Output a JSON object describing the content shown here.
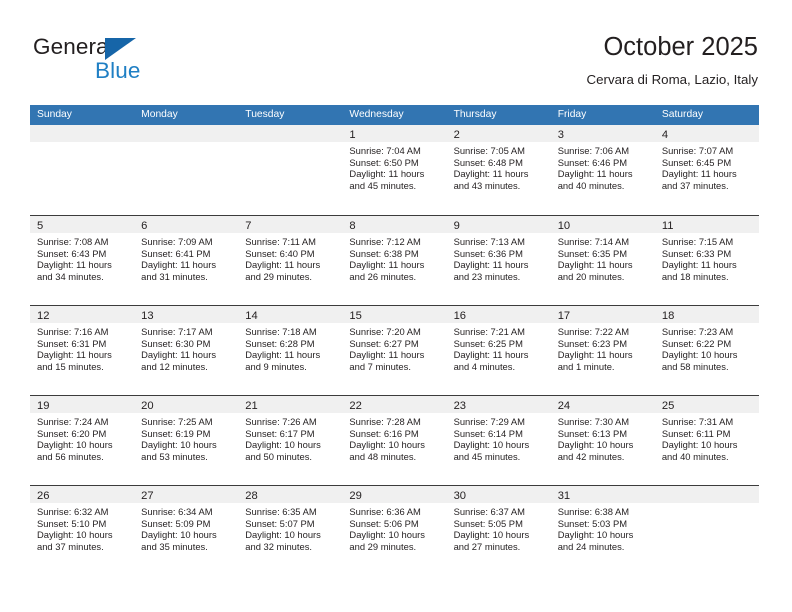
{
  "brand": {
    "name_top": "General",
    "name_bottom": "Blue",
    "triangle_color": "#1665a8",
    "blue_text_color": "#1f7fc4"
  },
  "header": {
    "title": "October 2025",
    "subtitle": "Cervara di Roma, Lazio, Italy"
  },
  "theme": {
    "header_blue": "#3275b2",
    "day_band_gray": "#f0f0f0",
    "rule_color": "#3c3c3c",
    "text_color": "#231f20"
  },
  "weekdays": [
    "Sunday",
    "Monday",
    "Tuesday",
    "Wednesday",
    "Thursday",
    "Friday",
    "Saturday"
  ],
  "weeks": [
    [
      {
        "empty": true
      },
      {
        "empty": true
      },
      {
        "empty": true
      },
      {
        "day": "1",
        "sunrise": "Sunrise: 7:04 AM",
        "sunset": "Sunset: 6:50 PM",
        "daylight": "Daylight: 11 hours and 45 minutes."
      },
      {
        "day": "2",
        "sunrise": "Sunrise: 7:05 AM",
        "sunset": "Sunset: 6:48 PM",
        "daylight": "Daylight: 11 hours and 43 minutes."
      },
      {
        "day": "3",
        "sunrise": "Sunrise: 7:06 AM",
        "sunset": "Sunset: 6:46 PM",
        "daylight": "Daylight: 11 hours and 40 minutes."
      },
      {
        "day": "4",
        "sunrise": "Sunrise: 7:07 AM",
        "sunset": "Sunset: 6:45 PM",
        "daylight": "Daylight: 11 hours and 37 minutes."
      }
    ],
    [
      {
        "day": "5",
        "sunrise": "Sunrise: 7:08 AM",
        "sunset": "Sunset: 6:43 PM",
        "daylight": "Daylight: 11 hours and 34 minutes."
      },
      {
        "day": "6",
        "sunrise": "Sunrise: 7:09 AM",
        "sunset": "Sunset: 6:41 PM",
        "daylight": "Daylight: 11 hours and 31 minutes."
      },
      {
        "day": "7",
        "sunrise": "Sunrise: 7:11 AM",
        "sunset": "Sunset: 6:40 PM",
        "daylight": "Daylight: 11 hours and 29 minutes."
      },
      {
        "day": "8",
        "sunrise": "Sunrise: 7:12 AM",
        "sunset": "Sunset: 6:38 PM",
        "daylight": "Daylight: 11 hours and 26 minutes."
      },
      {
        "day": "9",
        "sunrise": "Sunrise: 7:13 AM",
        "sunset": "Sunset: 6:36 PM",
        "daylight": "Daylight: 11 hours and 23 minutes."
      },
      {
        "day": "10",
        "sunrise": "Sunrise: 7:14 AM",
        "sunset": "Sunset: 6:35 PM",
        "daylight": "Daylight: 11 hours and 20 minutes."
      },
      {
        "day": "11",
        "sunrise": "Sunrise: 7:15 AM",
        "sunset": "Sunset: 6:33 PM",
        "daylight": "Daylight: 11 hours and 18 minutes."
      }
    ],
    [
      {
        "day": "12",
        "sunrise": "Sunrise: 7:16 AM",
        "sunset": "Sunset: 6:31 PM",
        "daylight": "Daylight: 11 hours and 15 minutes."
      },
      {
        "day": "13",
        "sunrise": "Sunrise: 7:17 AM",
        "sunset": "Sunset: 6:30 PM",
        "daylight": "Daylight: 11 hours and 12 minutes."
      },
      {
        "day": "14",
        "sunrise": "Sunrise: 7:18 AM",
        "sunset": "Sunset: 6:28 PM",
        "daylight": "Daylight: 11 hours and 9 minutes."
      },
      {
        "day": "15",
        "sunrise": "Sunrise: 7:20 AM",
        "sunset": "Sunset: 6:27 PM",
        "daylight": "Daylight: 11 hours and 7 minutes."
      },
      {
        "day": "16",
        "sunrise": "Sunrise: 7:21 AM",
        "sunset": "Sunset: 6:25 PM",
        "daylight": "Daylight: 11 hours and 4 minutes."
      },
      {
        "day": "17",
        "sunrise": "Sunrise: 7:22 AM",
        "sunset": "Sunset: 6:23 PM",
        "daylight": "Daylight: 11 hours and 1 minute."
      },
      {
        "day": "18",
        "sunrise": "Sunrise: 7:23 AM",
        "sunset": "Sunset: 6:22 PM",
        "daylight": "Daylight: 10 hours and 58 minutes."
      }
    ],
    [
      {
        "day": "19",
        "sunrise": "Sunrise: 7:24 AM",
        "sunset": "Sunset: 6:20 PM",
        "daylight": "Daylight: 10 hours and 56 minutes."
      },
      {
        "day": "20",
        "sunrise": "Sunrise: 7:25 AM",
        "sunset": "Sunset: 6:19 PM",
        "daylight": "Daylight: 10 hours and 53 minutes."
      },
      {
        "day": "21",
        "sunrise": "Sunrise: 7:26 AM",
        "sunset": "Sunset: 6:17 PM",
        "daylight": "Daylight: 10 hours and 50 minutes."
      },
      {
        "day": "22",
        "sunrise": "Sunrise: 7:28 AM",
        "sunset": "Sunset: 6:16 PM",
        "daylight": "Daylight: 10 hours and 48 minutes."
      },
      {
        "day": "23",
        "sunrise": "Sunrise: 7:29 AM",
        "sunset": "Sunset: 6:14 PM",
        "daylight": "Daylight: 10 hours and 45 minutes."
      },
      {
        "day": "24",
        "sunrise": "Sunrise: 7:30 AM",
        "sunset": "Sunset: 6:13 PM",
        "daylight": "Daylight: 10 hours and 42 minutes."
      },
      {
        "day": "25",
        "sunrise": "Sunrise: 7:31 AM",
        "sunset": "Sunset: 6:11 PM",
        "daylight": "Daylight: 10 hours and 40 minutes."
      }
    ],
    [
      {
        "day": "26",
        "sunrise": "Sunrise: 6:32 AM",
        "sunset": "Sunset: 5:10 PM",
        "daylight": "Daylight: 10 hours and 37 minutes."
      },
      {
        "day": "27",
        "sunrise": "Sunrise: 6:34 AM",
        "sunset": "Sunset: 5:09 PM",
        "daylight": "Daylight: 10 hours and 35 minutes."
      },
      {
        "day": "28",
        "sunrise": "Sunrise: 6:35 AM",
        "sunset": "Sunset: 5:07 PM",
        "daylight": "Daylight: 10 hours and 32 minutes."
      },
      {
        "day": "29",
        "sunrise": "Sunrise: 6:36 AM",
        "sunset": "Sunset: 5:06 PM",
        "daylight": "Daylight: 10 hours and 29 minutes."
      },
      {
        "day": "30",
        "sunrise": "Sunrise: 6:37 AM",
        "sunset": "Sunset: 5:05 PM",
        "daylight": "Daylight: 10 hours and 27 minutes."
      },
      {
        "day": "31",
        "sunrise": "Sunrise: 6:38 AM",
        "sunset": "Sunset: 5:03 PM",
        "daylight": "Daylight: 10 hours and 24 minutes."
      },
      {
        "empty": true
      }
    ]
  ]
}
